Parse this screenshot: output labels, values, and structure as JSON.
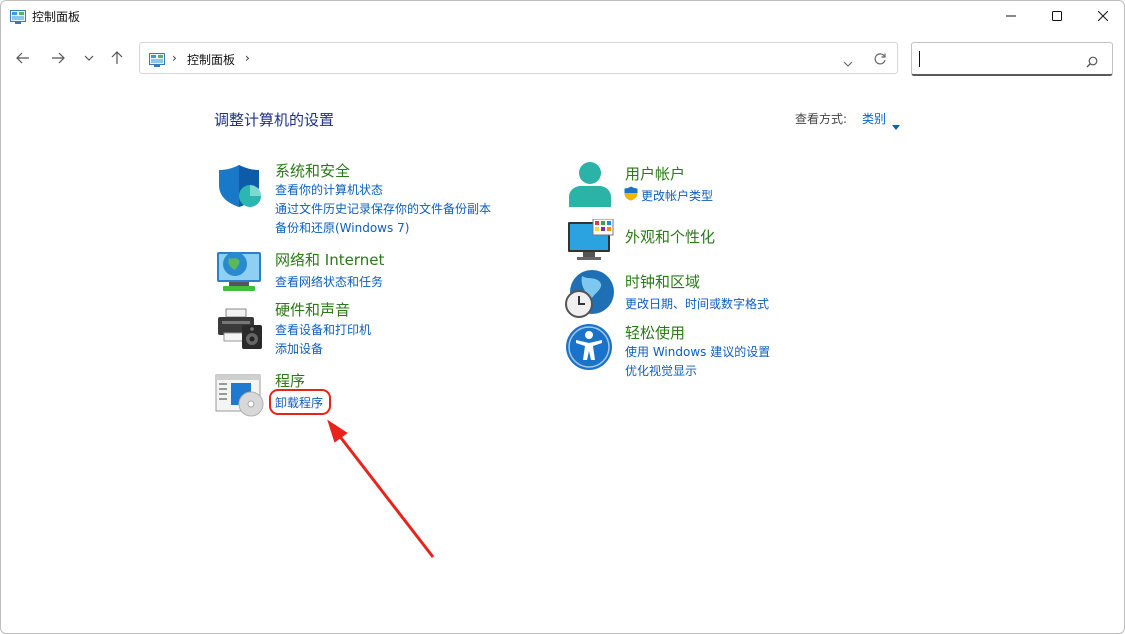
{
  "window": {
    "title": "控制面板"
  },
  "address": {
    "crumb": "控制面板",
    "separator": "›"
  },
  "search": {
    "placeholder": "",
    "value": ""
  },
  "header": {
    "title": "调整计算机的设置",
    "view_by_label": "查看方式:",
    "view_by_value": "类别"
  },
  "categories": [
    {
      "title": "系统和安全",
      "icon": "shield-icon",
      "links": [
        "查看你的计算机状态",
        "通过文件历史记录保存你的文件备份副本",
        "备份和还原(Windows 7)"
      ]
    },
    {
      "title": "网络和 Internet",
      "icon": "network-globe-icon",
      "links": [
        "查看网络状态和任务"
      ]
    },
    {
      "title": "硬件和声音",
      "icon": "printer-speaker-icon",
      "links": [
        "查看设备和打印机",
        "添加设备"
      ]
    },
    {
      "title": "程序",
      "icon": "programs-disc-icon",
      "links": [
        "卸载程序"
      ]
    },
    {
      "title": "用户帐户",
      "icon": "user-account-icon",
      "links": [
        "更改帐户类型"
      ]
    },
    {
      "title": "外观和个性化",
      "icon": "monitor-palette-icon",
      "links": []
    },
    {
      "title": "时钟和区域",
      "icon": "clock-globe-icon",
      "links": [
        "更改日期、时间或数字格式"
      ]
    },
    {
      "title": "轻松使用",
      "icon": "accessibility-icon",
      "links": [
        "使用 Windows 建议的设置",
        "优化视觉显示"
      ]
    }
  ],
  "colors": {
    "category_title": "#2a7a16",
    "link": "#0d5fbe",
    "page_title": "#1e3287",
    "annotation": "#e8231c"
  }
}
